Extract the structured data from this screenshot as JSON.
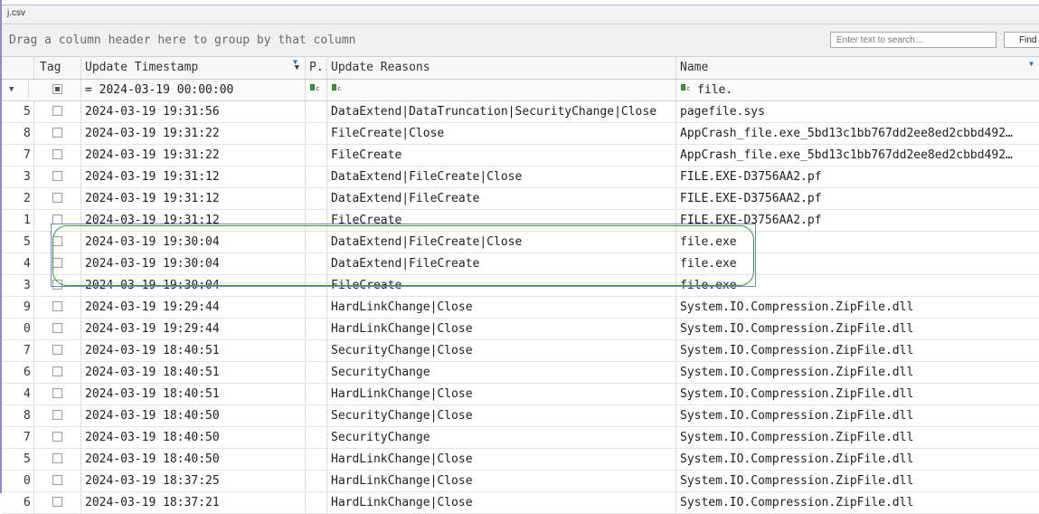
{
  "tab": {
    "label": "j.csv"
  },
  "groupbar": {
    "hint": "Drag a column header here to group by that column",
    "search_placeholder": "Enter text to search...",
    "find_label": "Find"
  },
  "columns": {
    "tag": "Tag",
    "update_timestamp": "Update Timestamp",
    "p": "P...",
    "update_reasons": "Update Reasons",
    "name": "Name"
  },
  "filter_row": {
    "timestamp": "= 2024-03-19 00:00:00",
    "name": "file."
  },
  "rows": [
    {
      "line": "5",
      "timestamp": "2024-03-19 19:31:56",
      "reasons": "DataExtend|DataTruncation|SecurityChange|Close",
      "name": "pagefile.sys"
    },
    {
      "line": "8",
      "timestamp": "2024-03-19 19:31:22",
      "reasons": "FileCreate|Close",
      "name": "AppCrash_file.exe_5bd13c1bb767dd2ee8ed2cbbd492…"
    },
    {
      "line": "7",
      "timestamp": "2024-03-19 19:31:22",
      "reasons": "FileCreate",
      "name": "AppCrash_file.exe_5bd13c1bb767dd2ee8ed2cbbd492…"
    },
    {
      "line": "3",
      "timestamp": "2024-03-19 19:31:12",
      "reasons": "DataExtend|FileCreate|Close",
      "name": "FILE.EXE-D3756AA2.pf"
    },
    {
      "line": "2",
      "timestamp": "2024-03-19 19:31:12",
      "reasons": "DataExtend|FileCreate",
      "name": "FILE.EXE-D3756AA2.pf"
    },
    {
      "line": "1",
      "timestamp": "2024-03-19 19:31:12",
      "reasons": "FileCreate",
      "name": "FILE.EXE-D3756AA2.pf"
    },
    {
      "line": "5",
      "timestamp": "2024-03-19 19:30:04",
      "reasons": "DataExtend|FileCreate|Close",
      "name": "file.exe"
    },
    {
      "line": "4",
      "timestamp": "2024-03-19 19:30:04",
      "reasons": "DataExtend|FileCreate",
      "name": "file.exe"
    },
    {
      "line": "3",
      "timestamp": "2024-03-19 19:30:04",
      "reasons": "FileCreate",
      "name": "file.exe"
    },
    {
      "line": "9",
      "timestamp": "2024-03-19 19:29:44",
      "reasons": "HardLinkChange|Close",
      "name": "System.IO.Compression.ZipFile.dll"
    },
    {
      "line": "0",
      "timestamp": "2024-03-19 19:29:44",
      "reasons": "HardLinkChange|Close",
      "name": "System.IO.Compression.ZipFile.dll"
    },
    {
      "line": "7",
      "timestamp": "2024-03-19 18:40:51",
      "reasons": "SecurityChange|Close",
      "name": "System.IO.Compression.ZipFile.dll"
    },
    {
      "line": "6",
      "timestamp": "2024-03-19 18:40:51",
      "reasons": "SecurityChange",
      "name": "System.IO.Compression.ZipFile.dll"
    },
    {
      "line": "4",
      "timestamp": "2024-03-19 18:40:51",
      "reasons": "HardLinkChange|Close",
      "name": "System.IO.Compression.ZipFile.dll"
    },
    {
      "line": "8",
      "timestamp": "2024-03-19 18:40:50",
      "reasons": "SecurityChange|Close",
      "name": "System.IO.Compression.ZipFile.dll"
    },
    {
      "line": "7",
      "timestamp": "2024-03-19 18:40:50",
      "reasons": "SecurityChange",
      "name": "System.IO.Compression.ZipFile.dll"
    },
    {
      "line": "5",
      "timestamp": "2024-03-19 18:40:50",
      "reasons": "HardLinkChange|Close",
      "name": "System.IO.Compression.ZipFile.dll"
    },
    {
      "line": "0",
      "timestamp": "2024-03-19 18:37:25",
      "reasons": "HardLinkChange|Close",
      "name": "System.IO.Compression.ZipFile.dll"
    },
    {
      "line": "6",
      "timestamp": "2024-03-19 18:37:21",
      "reasons": "HardLinkChange|Close",
      "name": "System.IO.Compression.ZipFile.dll"
    }
  ],
  "icons": {
    "sort": "sort-descending-icon",
    "filter": "filter-icon",
    "funnel": "funnel-icon"
  },
  "colors": {
    "highlight_oval": "#2e9d2e",
    "selection_box": "#7f7fd8"
  }
}
